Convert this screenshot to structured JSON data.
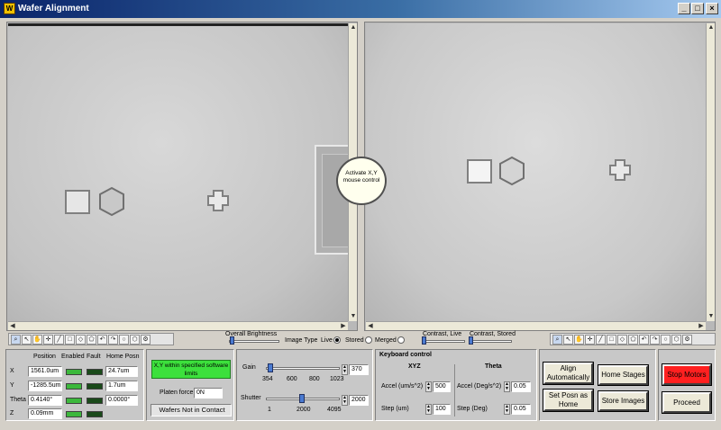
{
  "window": {
    "title": "Wafer Alignment",
    "minimize": "_",
    "maximize": "□",
    "close": "×",
    "app_icon": "W"
  },
  "overlay": {
    "activate": "Activate X,Y mouse control"
  },
  "toolbar_icons": [
    "⌕",
    "↖",
    "✋",
    "✛",
    "╱",
    "□",
    "◇",
    "⬠",
    "↶",
    "↷",
    "○",
    "⬡",
    "⚙"
  ],
  "center_controls": {
    "overall_brightness": "Overall Brightness",
    "image_type": "Image Type",
    "live": "Live",
    "stored": "Stored",
    "merged": "Merged",
    "contrast_live": "Contrast, Live",
    "contrast_stored": "Contrast, Stored",
    "selected_image_type": "Live"
  },
  "axes": {
    "headers": {
      "position": "Position",
      "enabled": "Enabled",
      "fault": "Fault",
      "home_posn": "Home Posn"
    },
    "rows": [
      {
        "name": "X",
        "position": "1561.0um",
        "home": "24.7um",
        "enabled": true
      },
      {
        "name": "Y",
        "position": "-1285.5um",
        "home": "1.7um",
        "enabled": true
      },
      {
        "name": "Theta",
        "position": "0.4140°",
        "home": "0.0000°",
        "enabled": true
      },
      {
        "name": "Z",
        "position": "0.09mm",
        "home": "",
        "enabled": true
      }
    ]
  },
  "status": {
    "limits": "X,Y within specified software limits",
    "platen_label": "Platen force",
    "platen_value": "0N",
    "contact": "Wafers Not in Contact",
    "limits_color": "#3ce03c"
  },
  "camera": {
    "gain_label": "Gain",
    "gain_value": "370",
    "gain_ticks": [
      "354",
      "600",
      "800",
      "1023"
    ],
    "gain_level": 0.02,
    "shutter_label": "Shutter",
    "shutter_value": "2000",
    "shutter_ticks": [
      "1",
      "2000",
      "4095"
    ],
    "shutter_level": 0.49
  },
  "keyboard": {
    "title": "Keyboard control",
    "xyz_title": "XYZ",
    "theta_title": "Theta",
    "xyz_accel_label": "Accel (um/s^2)",
    "xyz_accel": "500",
    "xyz_step_label": "Step (um)",
    "xyz_step": "100",
    "theta_accel_label": "Accel (Deg/s^2)",
    "theta_accel": "0.05",
    "theta_step_label": "Step (Deg)",
    "theta_step": "0.05"
  },
  "buttons": {
    "align": "Align Automatically",
    "home_stages": "Home Stages",
    "set_home": "Set Posn as Home",
    "store_images": "Store Images",
    "stop_motors": "Stop Motors",
    "proceed": "Proceed"
  },
  "colors": {
    "stop": "#ff2020",
    "limits_ok": "#3ce03c"
  }
}
